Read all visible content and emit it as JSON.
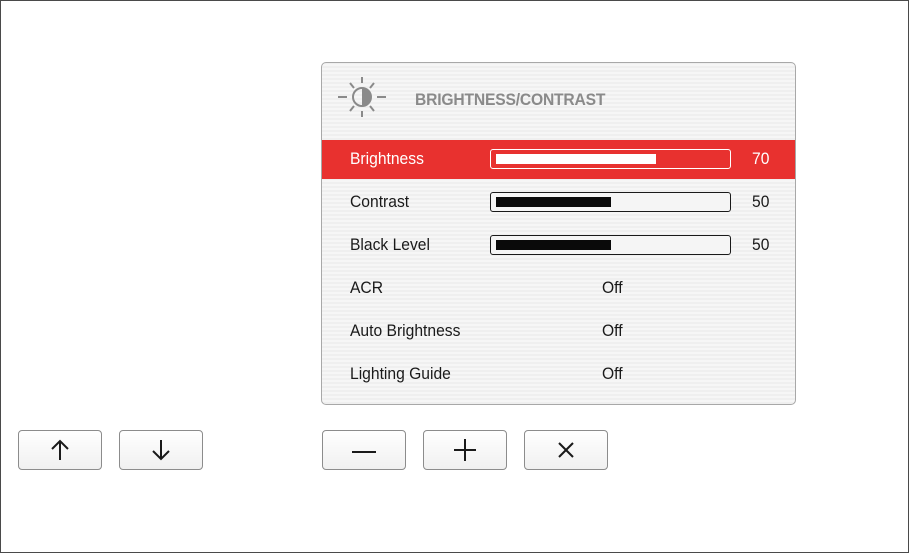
{
  "osd": {
    "title": "BRIGHTNESS/CONTRAST",
    "header_icon": "brightness-sun-icon",
    "accent_color": "#e8312f",
    "rows": [
      {
        "label": "Brightness",
        "type": "slider",
        "value": "70",
        "level": 0.7,
        "selected": true
      },
      {
        "label": "Contrast",
        "type": "slider",
        "value": "50",
        "level": 0.5,
        "selected": false
      },
      {
        "label": "Black Level",
        "type": "slider",
        "value": "50",
        "level": 0.5,
        "selected": false
      },
      {
        "label": "ACR",
        "type": "option",
        "value": "Off",
        "selected": false
      },
      {
        "label": "Auto Brightness",
        "type": "option",
        "value": "Off",
        "selected": false
      },
      {
        "label": "Lighting Guide",
        "type": "option",
        "value": "Off",
        "selected": false
      }
    ]
  },
  "buttons": [
    {
      "name": "up-button",
      "icon": "arrow-up-icon"
    },
    {
      "name": "down-button",
      "icon": "arrow-down-icon"
    },
    {
      "name": "minus-button",
      "icon": "minus-icon"
    },
    {
      "name": "plus-button",
      "icon": "plus-icon"
    },
    {
      "name": "close-button",
      "icon": "close-icon"
    }
  ]
}
